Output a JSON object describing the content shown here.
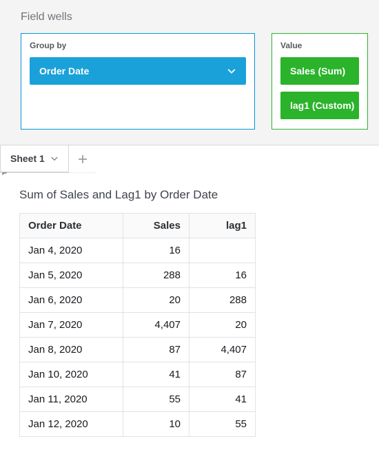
{
  "fieldWells": {
    "title": "Field wells",
    "groupBy": {
      "label": "Group by",
      "pills": [
        {
          "label": "Order Date"
        }
      ]
    },
    "value": {
      "label": "Value",
      "pills": [
        {
          "label": "Sales (Sum)"
        },
        {
          "label": "lag1 (Custom)"
        }
      ]
    }
  },
  "sheets": {
    "active": {
      "label": "Sheet 1"
    }
  },
  "visual": {
    "title": "Sum of Sales and Lag1 by Order Date",
    "columns": [
      {
        "key": "date",
        "label": "Order Date",
        "type": "date"
      },
      {
        "key": "sales",
        "label": "Sales",
        "type": "num"
      },
      {
        "key": "lag1",
        "label": "lag1",
        "type": "num"
      }
    ],
    "rows": [
      {
        "date": "Jan 4, 2020",
        "sales": "16",
        "lag1": ""
      },
      {
        "date": "Jan 5, 2020",
        "sales": "288",
        "lag1": "16"
      },
      {
        "date": "Jan 6, 2020",
        "sales": "20",
        "lag1": "288"
      },
      {
        "date": "Jan 7, 2020",
        "sales": "4,407",
        "lag1": "20"
      },
      {
        "date": "Jan 8, 2020",
        "sales": "87",
        "lag1": "4,407"
      },
      {
        "date": "Jan 10, 2020",
        "sales": "41",
        "lag1": "87"
      },
      {
        "date": "Jan 11, 2020",
        "sales": "55",
        "lag1": "41"
      },
      {
        "date": "Jan 12, 2020",
        "sales": "10",
        "lag1": "55"
      }
    ]
  }
}
